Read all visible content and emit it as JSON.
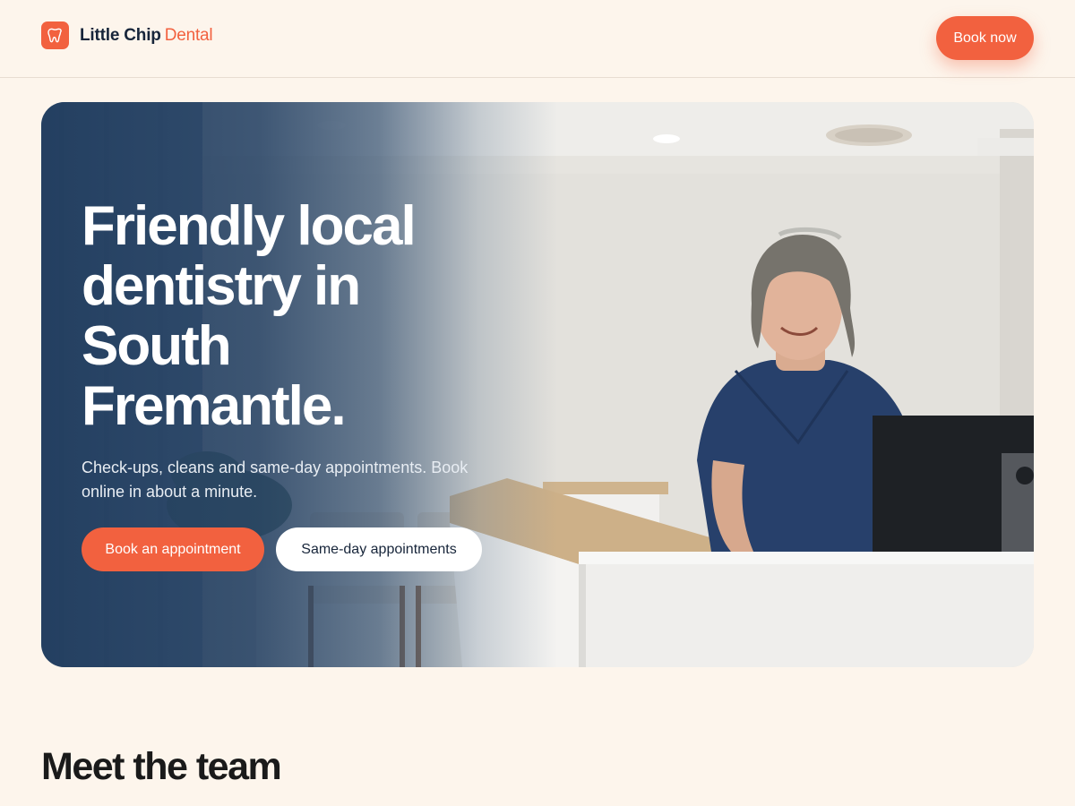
{
  "header": {
    "logo_strong": "Little Chip",
    "logo_accent": "Dental",
    "book_now_label": "Book now"
  },
  "hero": {
    "title": "Friendly local dentistry in South Fremantle.",
    "subtitle": "Check-ups, cleans and same-day appointments. Book online in about a minute.",
    "primary_cta": "Book an appointment",
    "secondary_cta": "Same-day appointments"
  },
  "team": {
    "title": "Meet the team"
  },
  "colors": {
    "accent": "#f2613f",
    "background": "#fdf5ec",
    "navy": "#17253a"
  },
  "icons": {
    "logo": "tooth-icon"
  }
}
